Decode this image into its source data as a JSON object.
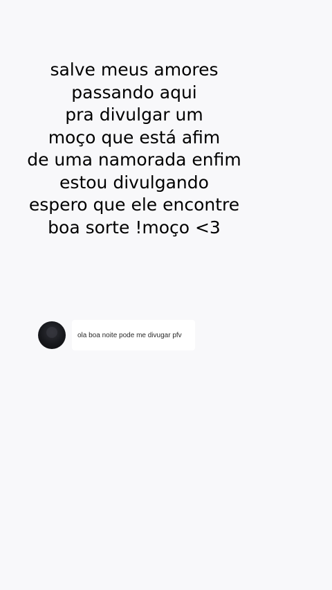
{
  "caption": {
    "lines": [
      "salve meus amores",
      "passando aqui",
      "pra divulgar um",
      "moço que está afim",
      "de uma namorada enfim",
      "estou divulgando",
      "espero que ele encontre",
      "boa sorte !moço <3"
    ]
  },
  "comment": {
    "avatar_icon": "avatar-dark",
    "text": "ola boa noite pode me divugar pfv"
  }
}
